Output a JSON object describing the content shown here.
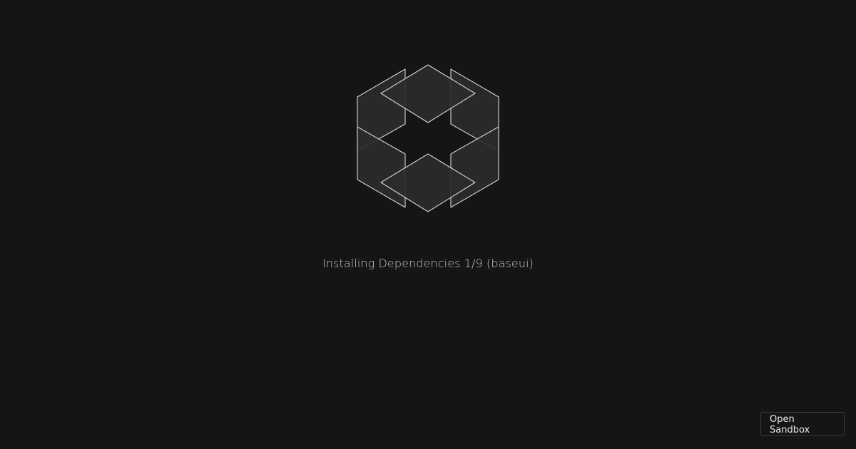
{
  "app": {
    "logo": "codesandbox-cube-icon",
    "status_text": "Installing Dependencies 1/9 (baseui)"
  },
  "actions": {
    "open_sandbox_label": "Open Sandbox"
  },
  "colors": {
    "background": "#151515",
    "logo_fill": "#2b2b2b",
    "logo_stroke": "#d6d6d6",
    "text": "#c8c8c8",
    "button_border": "#3b3b3b"
  }
}
